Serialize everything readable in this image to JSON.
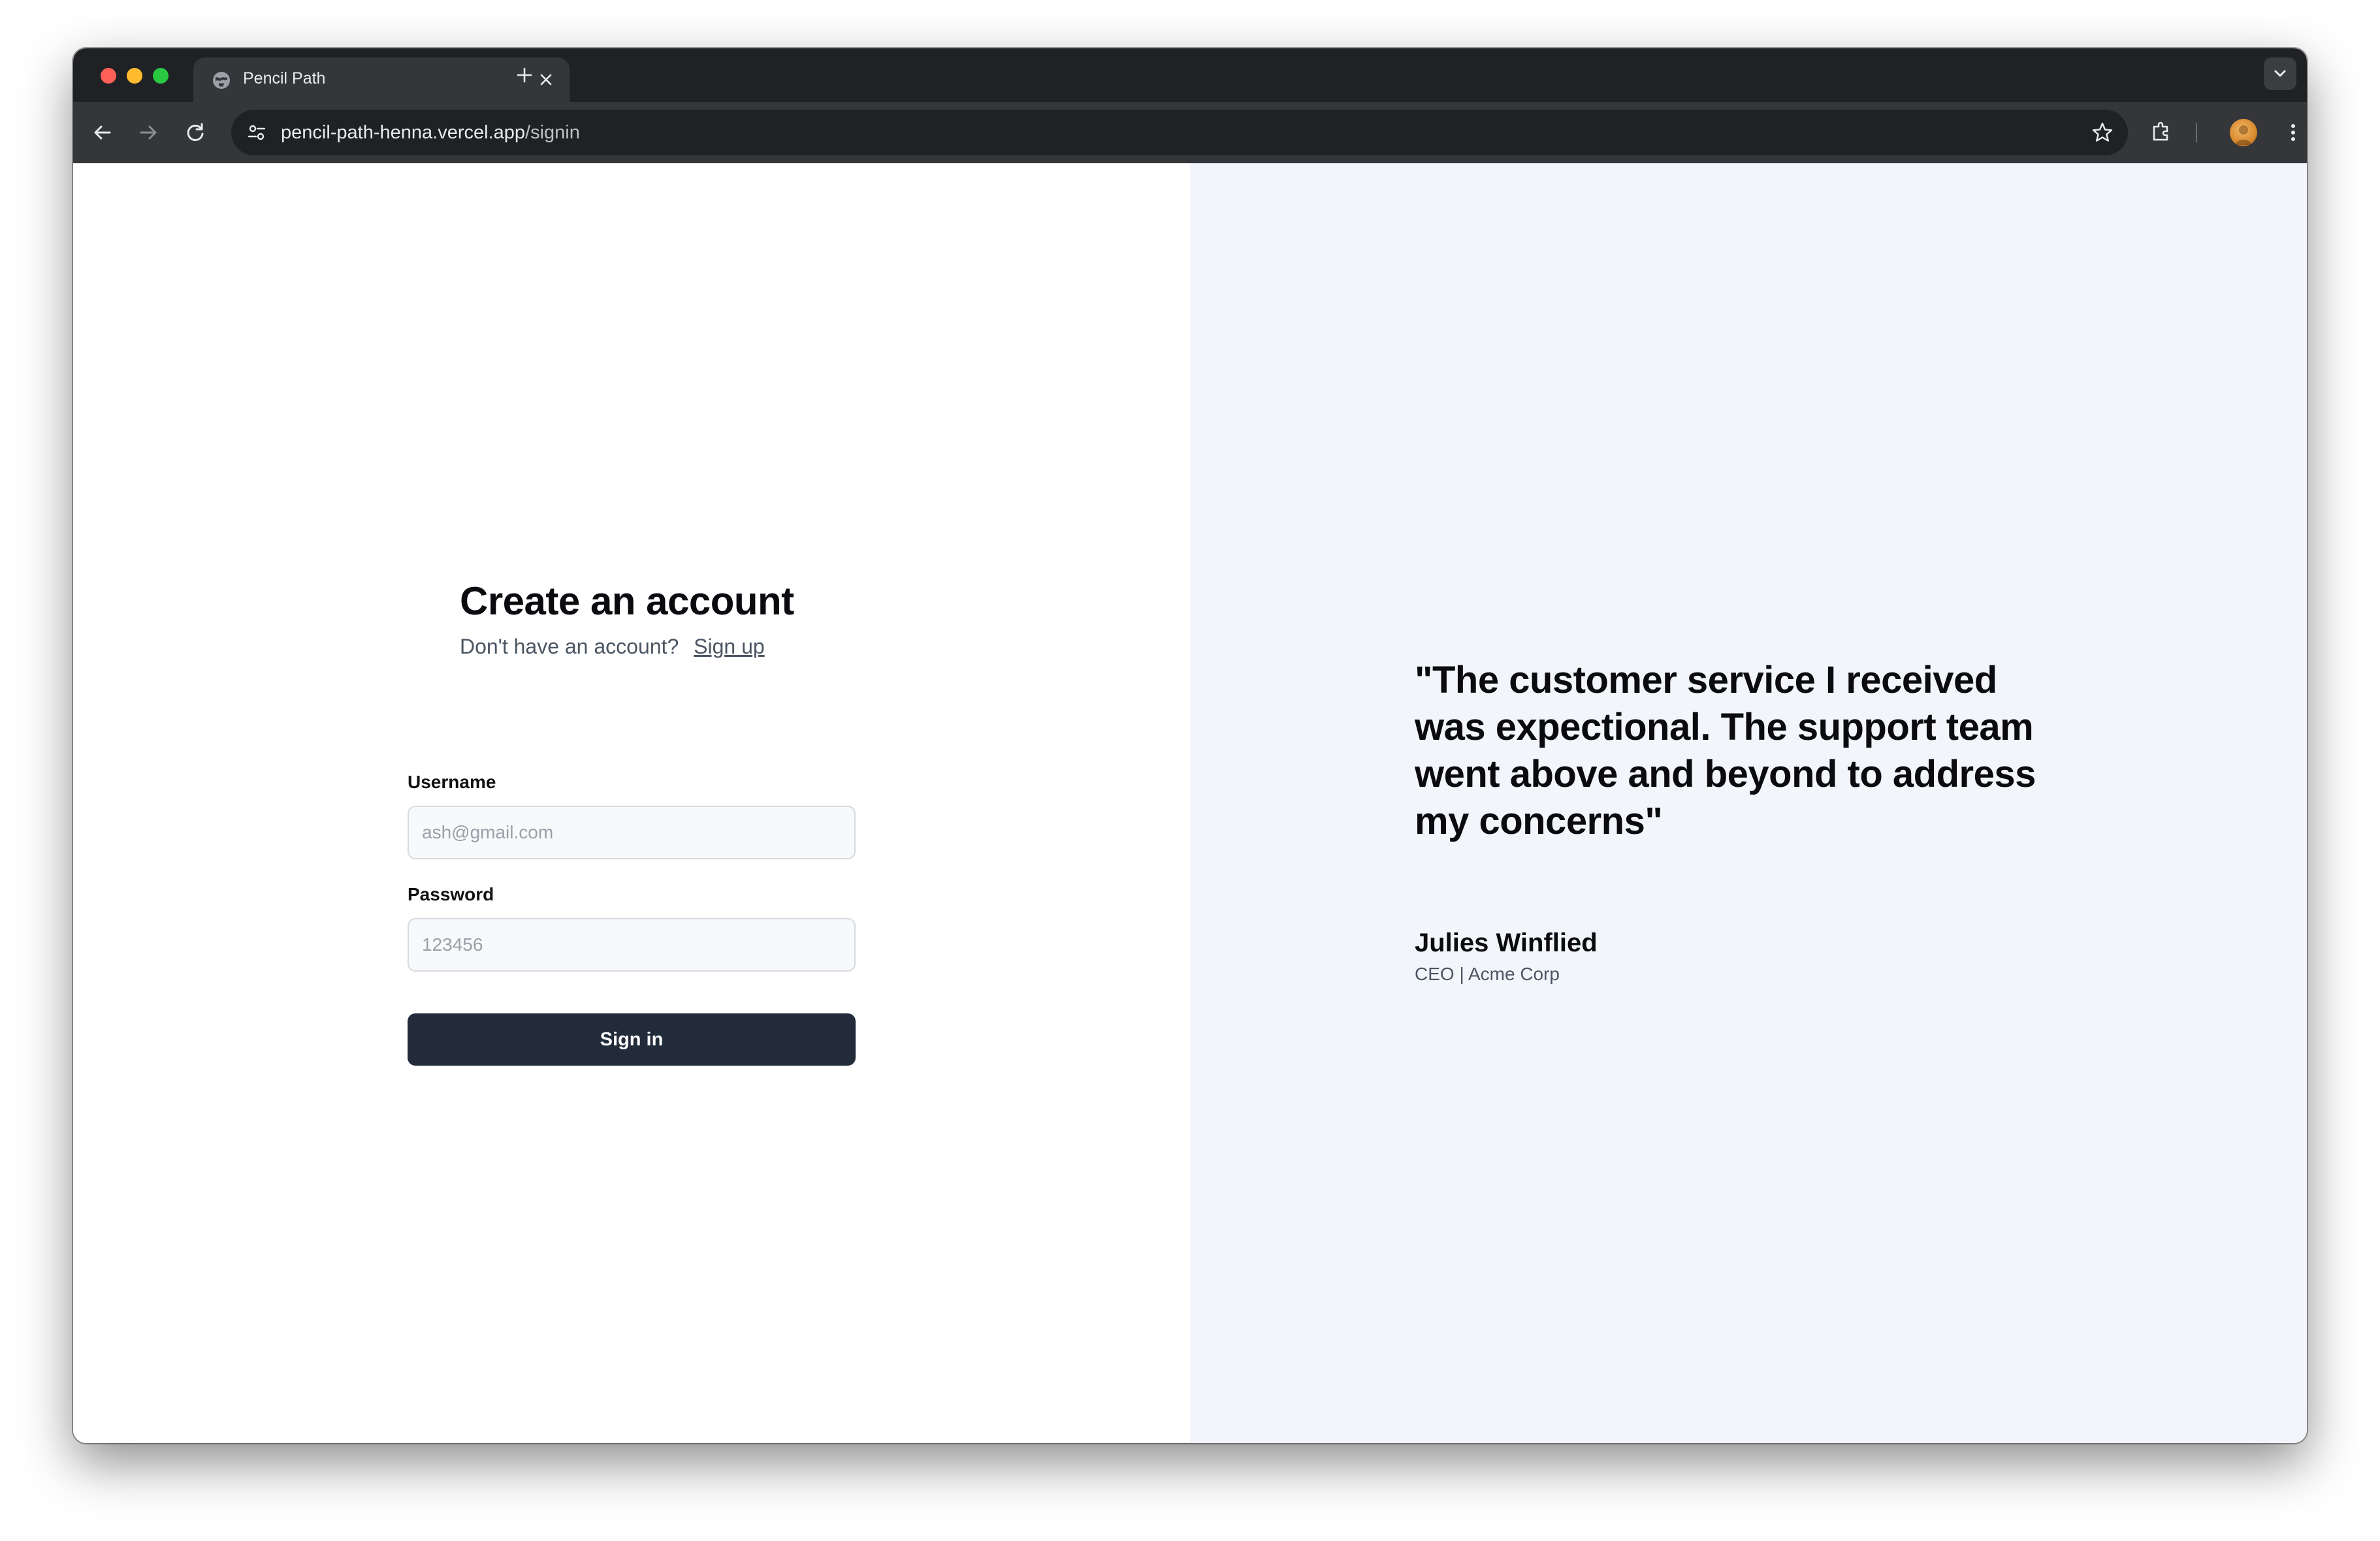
{
  "browser": {
    "tab_title": "Pencil Path",
    "url_host": "pencil-path-henna.vercel.app",
    "url_path": "/signin"
  },
  "signin": {
    "title": "Create an account",
    "prompt": "Don't have an account?",
    "signup_link": "Sign up",
    "username_label": "Username",
    "username_placeholder": "ash@gmail.com",
    "password_label": "Password",
    "password_placeholder": "123456",
    "submit_label": "Sign in"
  },
  "testimonial": {
    "quote": "\"The customer service I received was expectional. The support team went above and beyond to address my concerns\"",
    "author": "Julies Winflied",
    "role": "CEO | Acme Corp"
  },
  "colors": {
    "button_bg": "#222b3a",
    "right_panel_bg": "#f2f5f9",
    "chrome_dark": "#202124"
  }
}
